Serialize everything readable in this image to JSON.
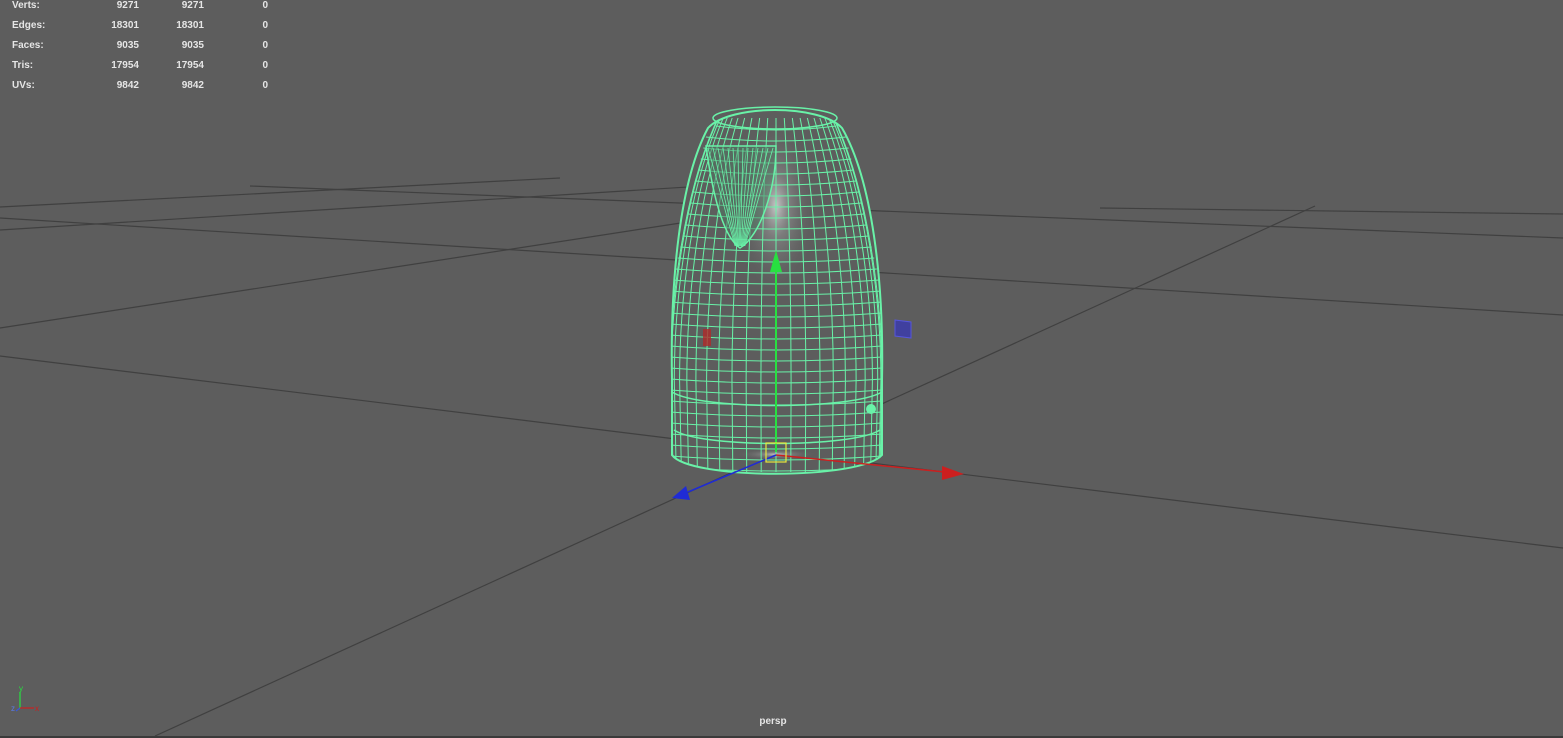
{
  "hud": {
    "rows": [
      {
        "label": "Verts:",
        "v1": "9271",
        "v2": "9271",
        "v3": "0"
      },
      {
        "label": "Edges:",
        "v1": "18301",
        "v2": "18301",
        "v3": "0"
      },
      {
        "label": "Faces:",
        "v1": "9035",
        "v2": "9035",
        "v3": "0"
      },
      {
        "label": "Tris:",
        "v1": "17954",
        "v2": "17954",
        "v3": "0"
      },
      {
        "label": "UVs:",
        "v1": "9842",
        "v2": "9842",
        "v3": "0"
      }
    ]
  },
  "viewport": {
    "camera_label": "persp",
    "background_color": "#5d5d5d",
    "grid_color": "#3f3f3f",
    "wireframe_color": "#69f2a8",
    "icons": [
      "move-manipulator-icon",
      "view-axis-indicator-icon"
    ]
  },
  "manipulator": {
    "x_axis_color": "#cc1f1f",
    "y_axis_color": "#27e040",
    "z_axis_color": "#1f2bd6",
    "pivot_color": "#e8e83c"
  },
  "axis_indicator": {
    "x_label": "x",
    "y_label": "y",
    "z_label": "z"
  }
}
